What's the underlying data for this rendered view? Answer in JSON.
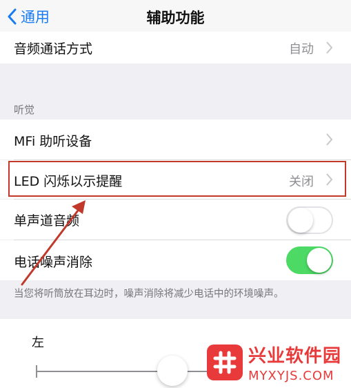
{
  "navbar": {
    "back_label": "通用",
    "title": "辅助功能"
  },
  "rows": {
    "audio_routing": {
      "label": "音频通话方式",
      "value": "自动"
    },
    "mfi_hearing": {
      "label": "MFi 助听设备"
    },
    "led_flash": {
      "label": "LED 闪烁以示提醒",
      "value": "关闭"
    },
    "mono_audio": {
      "label": "单声道音频",
      "toggle": "off"
    },
    "noise_cancel": {
      "label": "电话噪声消除",
      "toggle": "on"
    }
  },
  "section_header": "听觉",
  "footer_note": "当您将听筒放在耳边时，噪声消除将减少电话中的环境噪声。",
  "balance": {
    "left_label": "左",
    "position": 0.5
  },
  "watermark": {
    "name": "兴业软件园",
    "url": "MYXYJS.COM"
  },
  "colors": {
    "accent": "#1a7cf2",
    "toggle_on": "#4cd964",
    "highlight": "#c0392b",
    "background": "#efeff4",
    "watermark": "#e83a3a"
  }
}
